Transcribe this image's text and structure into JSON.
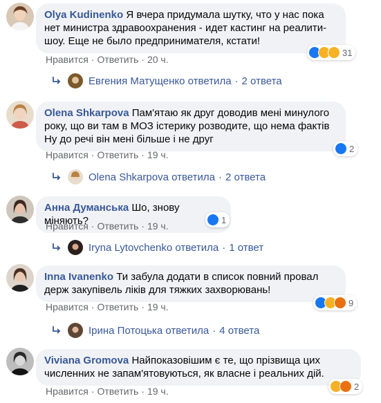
{
  "comments": [
    {
      "author": "Olya Kudinenko",
      "text": "Я вчера придумала шутку, что у нас пока нет министра здравоохранения - идет кастинг на реалити-шоу. Еще не было предпринимателя, кстати!",
      "like": "Нравится",
      "reply": "Ответить",
      "time": "20 ч.",
      "reaction_count": "31",
      "reactions": [
        "like-icon",
        "haha-icon",
        "sad-icon"
      ],
      "replies": {
        "name": "Евгения Матущенко ответила",
        "count": "2 ответа"
      }
    },
    {
      "author": "Olena Shkarpova",
      "text": "Пам'ятаю як друг доводив мені минулого року, що ви там в МОЗ істерику розводите, що нема фактів Ну до речі він мені більше і не друг",
      "like": "Нравится",
      "reply": "Ответить",
      "time": "19 ч.",
      "reaction_count": "2",
      "reactions": [
        "like-icon"
      ],
      "replies": {
        "name": "Olena Shkarpova ответила",
        "count": "2 ответа"
      }
    },
    {
      "author": "Анна Думанська",
      "text": "Шо, знову міняють?",
      "like": "Нравится",
      "reply": "Ответить",
      "time": "19 ч.",
      "reaction_count": "1",
      "reactions": [
        "like-icon"
      ],
      "replies": {
        "name": "Iryna Lytovchenko ответила",
        "count": "1 ответ"
      }
    },
    {
      "author": "Inna Ivanenko",
      "text": "Ти забула додати в список повний провал держ закупівель ліків для тяжких захворювань!",
      "like": "Нравится",
      "reply": "Ответить",
      "time": "19 ч.",
      "reaction_count": "9",
      "reactions": [
        "like-icon",
        "sad-icon",
        "angry-icon"
      ],
      "replies": {
        "name": "Ірина Потоцька ответила",
        "count": "4 ответа"
      }
    },
    {
      "author": "Viviana Gromova",
      "text": "Найпоказовішим є те, що прізвища цих численних не запам'ятовуються, як власне і реальних дій.",
      "like": "Нравится",
      "reply": "Ответить",
      "time": "19 ч.",
      "reaction_count": "2",
      "reactions": [
        "haha-icon",
        "angry-icon"
      ]
    }
  ],
  "colors": {
    "author": "#385898",
    "meta": "#65676b",
    "bubble": "#f0f2f5",
    "like": "#1877f2",
    "haha": "#f7b125",
    "angry": "#e9710f"
  }
}
